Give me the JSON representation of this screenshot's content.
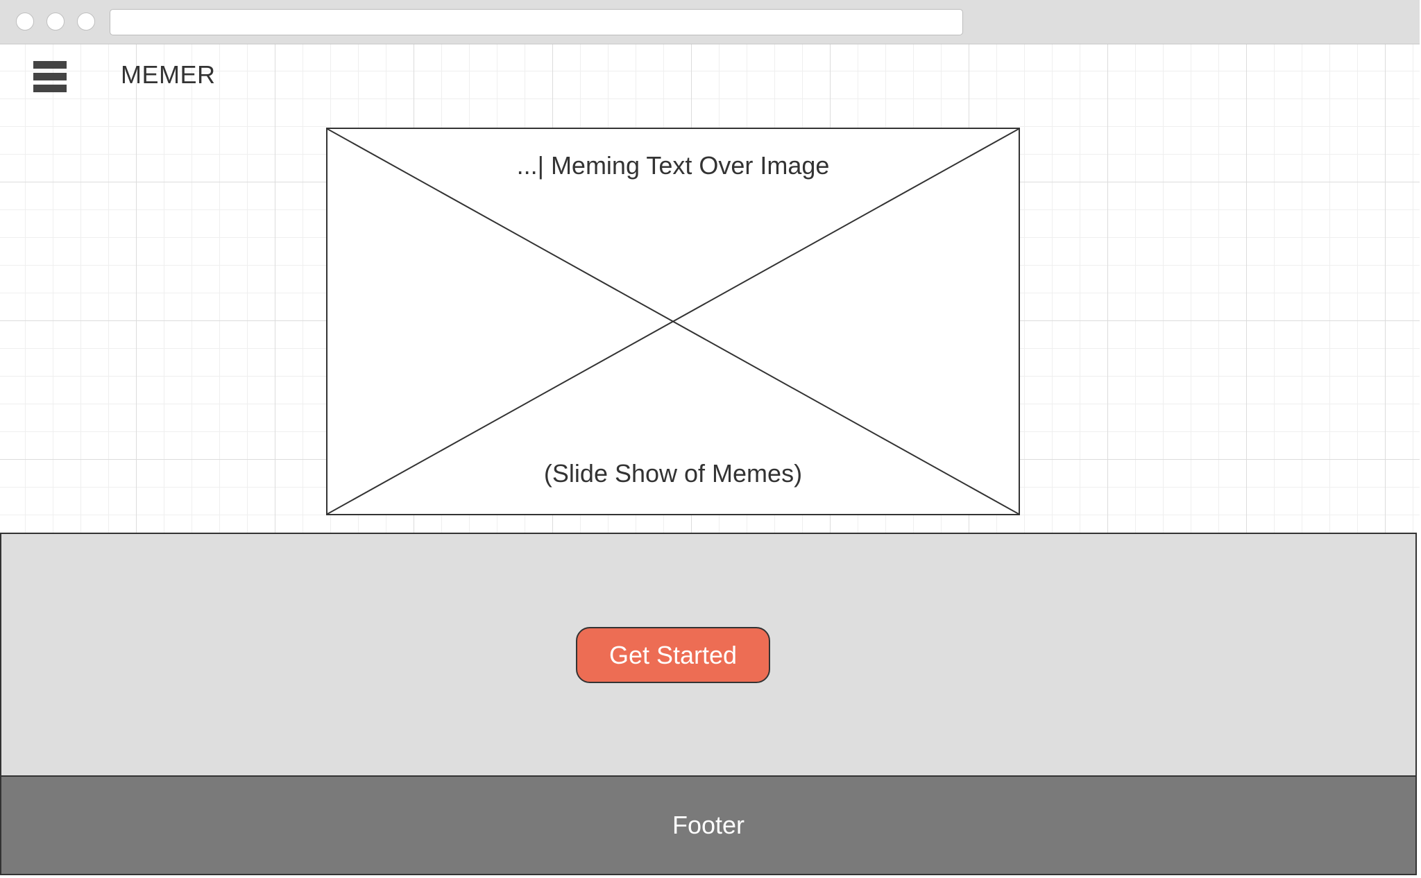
{
  "header": {
    "brand": "MEMER",
    "menu_icon": "hamburger-menu-icon"
  },
  "hero": {
    "image_placeholder_icon": "image-placeholder-icon",
    "overlay_text": "...| Meming Text Over Image",
    "caption": "(Slide Show of Memes)"
  },
  "cta": {
    "button_label": "Get Started",
    "button_color": "#ed6d54",
    "band_color": "#dedede"
  },
  "footer": {
    "label": "Footer",
    "background_color": "#7a7a7a"
  }
}
